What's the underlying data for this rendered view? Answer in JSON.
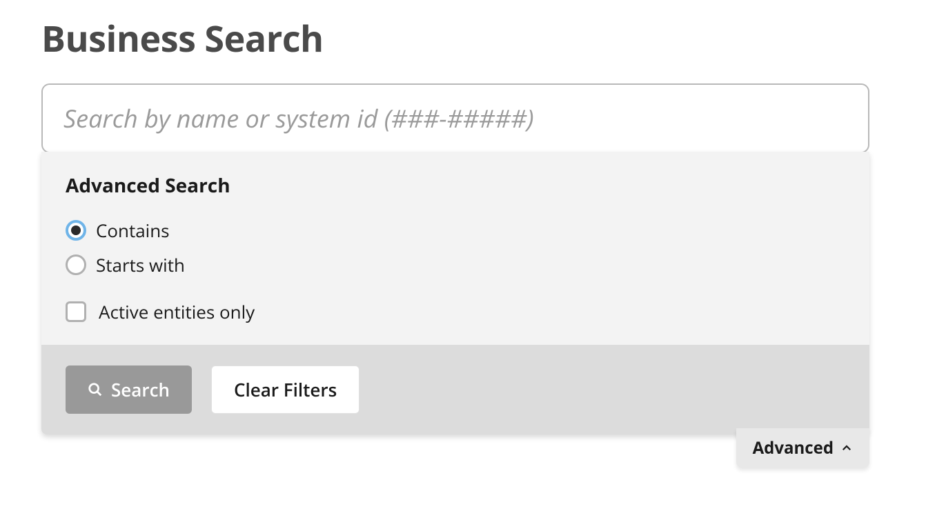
{
  "page": {
    "title": "Business Search"
  },
  "search": {
    "placeholder": "Search by name or system id (###-#####)",
    "value": ""
  },
  "advanced": {
    "heading": "Advanced Search",
    "radio_options": [
      {
        "label": "Contains",
        "selected": true
      },
      {
        "label": "Starts with",
        "selected": false
      }
    ],
    "checkbox": {
      "label": "Active entities only",
      "checked": false
    },
    "tab_label": "Advanced"
  },
  "buttons": {
    "search": "Search",
    "clear": "Clear Filters"
  }
}
